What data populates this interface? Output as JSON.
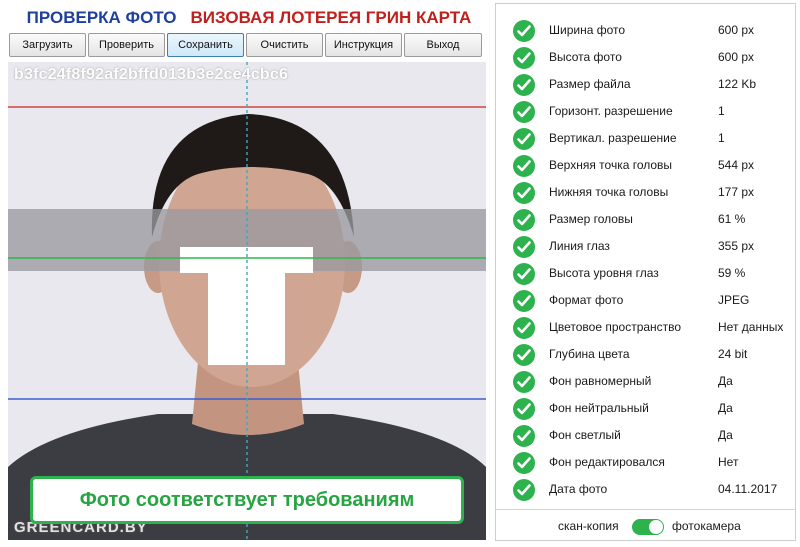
{
  "header": {
    "title_left": "ПРОВЕРКА ФОТО",
    "title_right": "ВИЗОВАЯ ЛОТЕРЕЯ ГРИН КАРТА"
  },
  "toolbar": {
    "buttons": [
      "Загрузить",
      "Проверить",
      "Сохранить",
      "Очистить",
      "Инструкция",
      "Выход"
    ],
    "active": "Сохранить"
  },
  "photo": {
    "hash": "b3fc24f8f92af2bffd013b3e2ce4cbc6",
    "watermark": "GREENCARD.BY",
    "status": "Фото соответствует требованиям"
  },
  "params": [
    {
      "label": "Ширина фото",
      "value": "600 px",
      "status": "ok"
    },
    {
      "label": "Высота фото",
      "value": "600 px",
      "status": "ok"
    },
    {
      "label": "Размер файла",
      "value": "122 Kb",
      "status": "ok"
    },
    {
      "label": "Горизонт. разрешение",
      "value": "1",
      "status": "ok"
    },
    {
      "label": "Вертикал. разрешение",
      "value": "1",
      "status": "ok"
    },
    {
      "label": "Верхняя точка головы",
      "value": "544 px",
      "status": "ok"
    },
    {
      "label": "Нижняя точка головы",
      "value": "177 px",
      "status": "ok"
    },
    {
      "label": "Размер головы",
      "value": "61 %",
      "status": "ok"
    },
    {
      "label": "Линия глаз",
      "value": "355 px",
      "status": "ok"
    },
    {
      "label": "Высота уровня глаз",
      "value": "59 %",
      "status": "ok"
    },
    {
      "label": "Формат фото",
      "value": "JPEG",
      "status": "ok"
    },
    {
      "label": "Цветовое пространство",
      "value": "Нет данных",
      "status": "ok"
    },
    {
      "label": "Глубина цвета",
      "value": "24 bit",
      "status": "ok"
    },
    {
      "label": "Фон равномерный",
      "value": "Да",
      "status": "ok"
    },
    {
      "label": "Фон нейтральный",
      "value": "Да",
      "status": "ok"
    },
    {
      "label": "Фон светлый",
      "value": "Да",
      "status": "ok"
    },
    {
      "label": "Фон редактировался",
      "value": "Нет",
      "status": "ok"
    },
    {
      "label": "Дата фото",
      "value": "04.11.2017",
      "status": "ok"
    }
  ],
  "mode_toggle": {
    "left_label": "скан-копия",
    "right_label": "фотокамера",
    "selected": "фотокамера"
  },
  "colors": {
    "ok_green": "#2db24e",
    "title_blue": "#1f3f9c",
    "title_red": "#c0201c",
    "top_line": "#d64040",
    "eye_line": "#2fb84a",
    "chin_line": "#3a5fcf",
    "center_line": "#4aa3b8"
  }
}
